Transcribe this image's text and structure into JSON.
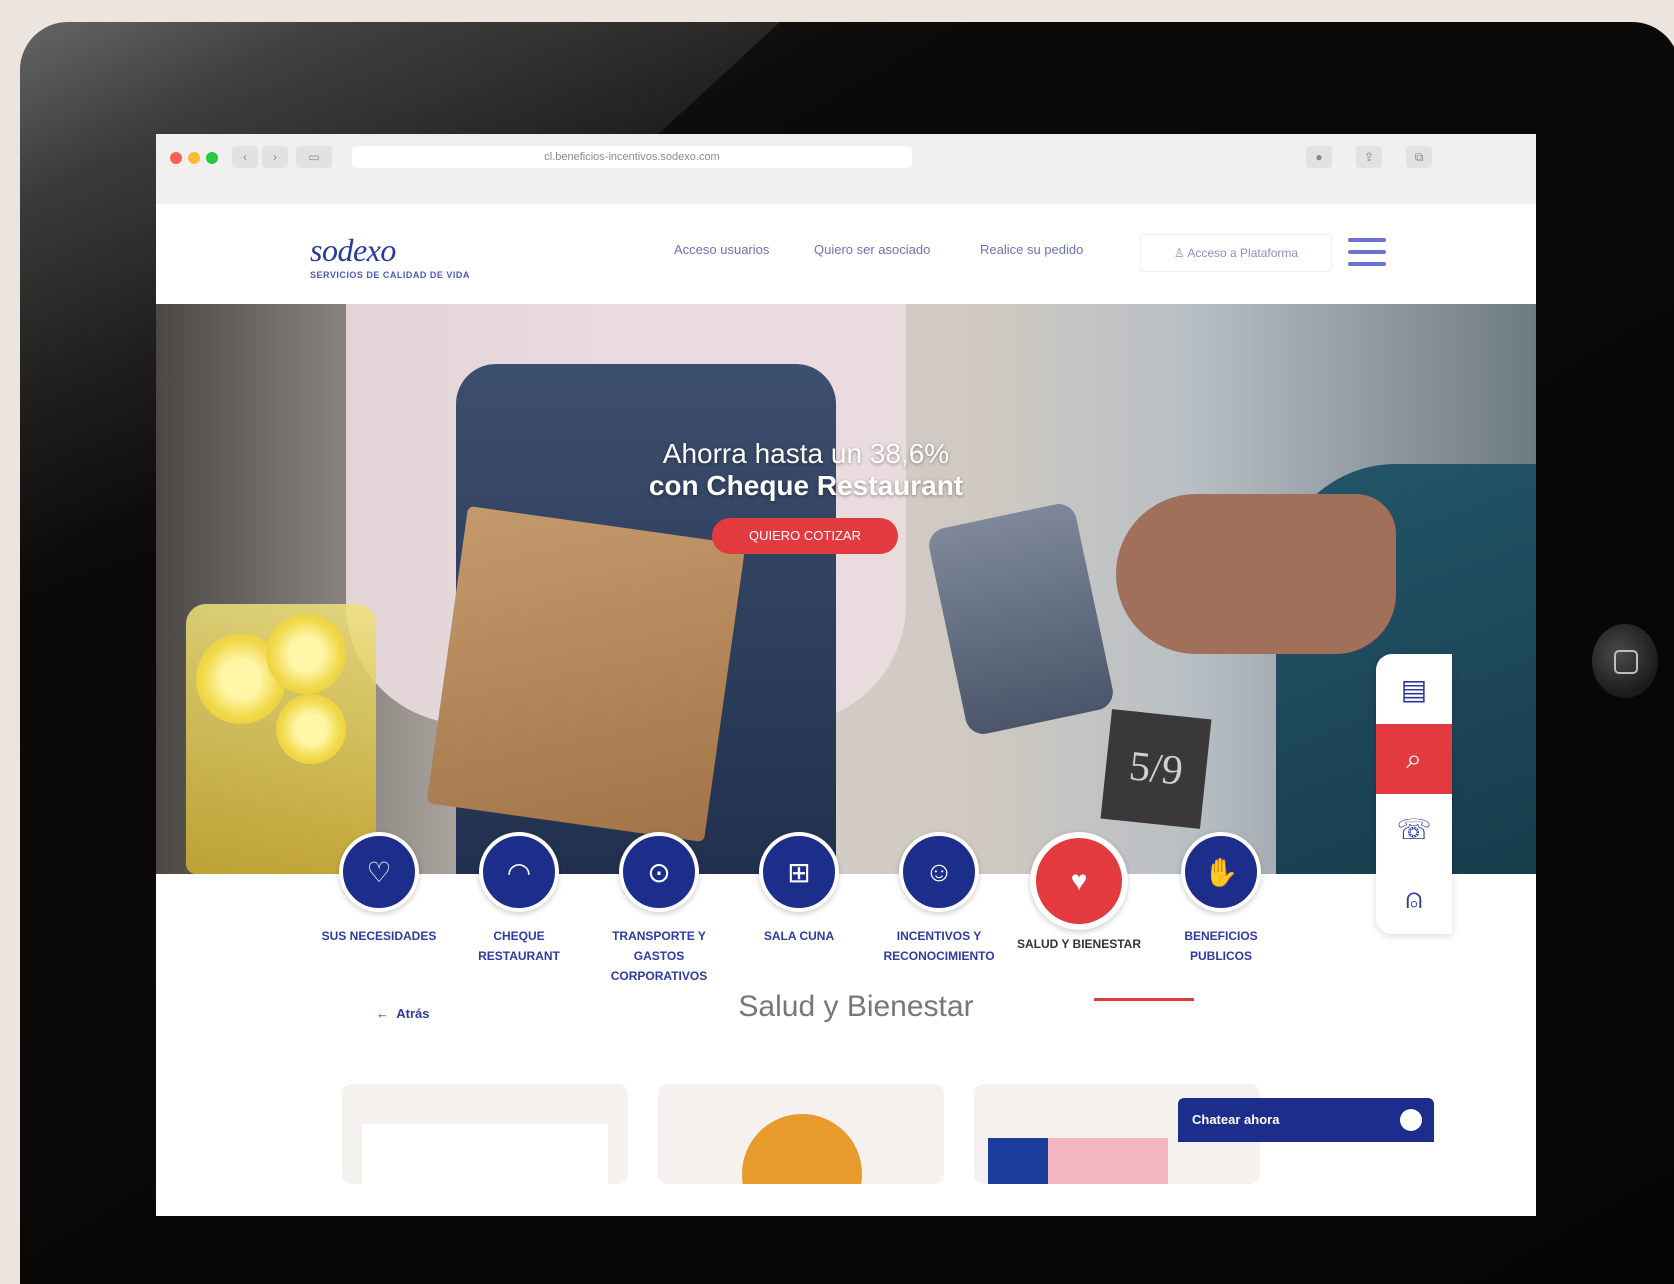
{
  "browser": {
    "url": "cl.beneficios-incentivos.sodexo.com"
  },
  "header": {
    "logo": "sodexo",
    "tagline": "SERVICIOS DE CALIDAD DE VIDA",
    "nav": [
      "Acceso usuarios",
      "Quiero ser asociado",
      "Realice su pedido"
    ],
    "platform": "Acceso a Plataforma"
  },
  "hero": {
    "line1": "Ahorra hasta un 38,6%",
    "line2": "con Cheque Restaurant",
    "cta": "QUIERO COTIZAR",
    "sign": "5/9"
  },
  "categories": [
    {
      "label": "SUS NECESIDADES",
      "icon": "heart-icon",
      "glyph": "♡"
    },
    {
      "label": "CHEQUE RESTAURANT",
      "icon": "cloche-icon",
      "glyph": "◠"
    },
    {
      "label": "TRANSPORTE Y GASTOS CORPORATIVOS",
      "icon": "location-pin-icon",
      "glyph": "⊙"
    },
    {
      "label": "SALA CUNA",
      "icon": "gift-icon",
      "glyph": "⊞"
    },
    {
      "label": "INCENTIVOS Y RECONOCIMIENTO",
      "icon": "theater-masks-icon",
      "glyph": "☺"
    },
    {
      "label": "SALUD Y BIENESTAR",
      "icon": "heart-pulse-icon",
      "glyph": "♥",
      "active": true
    },
    {
      "label": "BENEFICIOS PUBLICOS",
      "icon": "handshake-icon",
      "glyph": "✋"
    }
  ],
  "side_tools": [
    "calculator-icon",
    "search-icon",
    "phone-icon",
    "user-support-icon"
  ],
  "section": {
    "back": "Atrás",
    "title": "Salud y Bienestar"
  },
  "chat": {
    "label": "Chatear ahora"
  },
  "colors": {
    "brand_blue": "#1d2d8c",
    "accent_red": "#e23a3f"
  }
}
